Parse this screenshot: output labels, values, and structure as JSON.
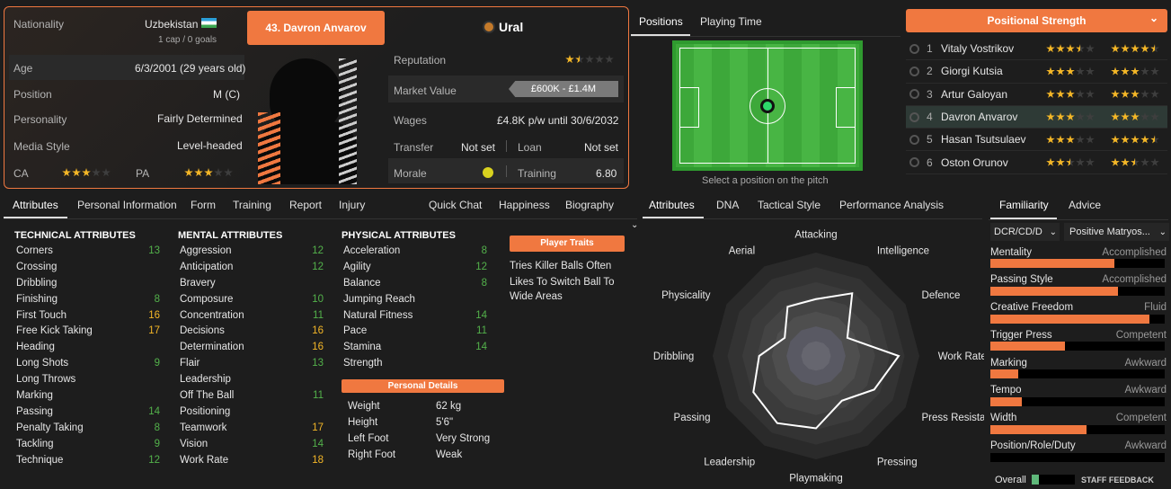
{
  "header": {
    "nationality_label": "Nationality",
    "nationality": "Uzbekistan",
    "caps": "1 cap / 0 goals",
    "player_button": "43. Davron Anvarov",
    "club": "Ural",
    "age_label": "Age",
    "age": "6/3/2001 (29 years old)",
    "position_label": "Position",
    "position": "M (C)",
    "personality_label": "Personality",
    "personality": "Fairly Determined",
    "media_label": "Media Style",
    "media": "Level-headed",
    "ca_label": "CA",
    "pa_label": "PA",
    "ca_stars": 3,
    "pa_stars": 3,
    "reputation_label": "Reputation",
    "reputation_stars": 1.5,
    "market_label": "Market Value",
    "market_value": "£600K - £1.4M",
    "wages_label": "Wages",
    "wages": "£4.8K p/w until 30/6/2032",
    "transfer_label": "Transfer",
    "transfer": "Not set",
    "loan_label": "Loan",
    "loan": "Not set",
    "morale_label": "Morale",
    "training_label": "Training",
    "training": "6.80"
  },
  "pitch": {
    "tabs": [
      "Positions",
      "Playing Time"
    ],
    "hint": "Select a position on the pitch"
  },
  "pos_strength": {
    "title": "Positional Strength",
    "rows": [
      {
        "n": "1",
        "name": "Vitaly Vostrikov",
        "a": 3.5,
        "b": 4.5,
        "sel": false
      },
      {
        "n": "2",
        "name": "Giorgi Kutsia",
        "a": 3,
        "b": 3,
        "sel": false
      },
      {
        "n": "3",
        "name": "Artur Galoyan",
        "a": 3,
        "b": 3,
        "sel": false
      },
      {
        "n": "4",
        "name": "Davron Anvarov",
        "a": 3,
        "b": 3,
        "sel": true
      },
      {
        "n": "5",
        "name": "Hasan Tsutsulaev",
        "a": 3,
        "b": 4.5,
        "sel": false
      },
      {
        "n": "6",
        "name": "Oston Orunov",
        "a": 2.5,
        "b": 2.5,
        "sel": false
      }
    ]
  },
  "main_tabs": [
    "Attributes",
    "Personal Information",
    "Form",
    "Training",
    "Report",
    "Injury",
    "Quick Chat",
    "Happiness",
    "Biography"
  ],
  "technical": {
    "title": "TECHNICAL ATTRIBUTES",
    "items": [
      [
        "Corners",
        "13",
        "g"
      ],
      [
        "Crossing",
        "",
        ""
      ],
      [
        "Dribbling",
        "",
        ""
      ],
      [
        "Finishing",
        "8",
        "g"
      ],
      [
        "First Touch",
        "16",
        "y"
      ],
      [
        "Free Kick Taking",
        "17",
        "y"
      ],
      [
        "Heading",
        "",
        ""
      ],
      [
        "Long Shots",
        "9",
        "g"
      ],
      [
        "Long Throws",
        "",
        ""
      ],
      [
        "Marking",
        "",
        ""
      ],
      [
        "Passing",
        "14",
        "g"
      ],
      [
        "Penalty Taking",
        "8",
        "g"
      ],
      [
        "Tackling",
        "9",
        "g"
      ],
      [
        "Technique",
        "12",
        "g"
      ]
    ]
  },
  "mental": {
    "title": "MENTAL ATTRIBUTES",
    "items": [
      [
        "Aggression",
        "12",
        "g"
      ],
      [
        "Anticipation",
        "12",
        "g"
      ],
      [
        "Bravery",
        "",
        ""
      ],
      [
        "Composure",
        "10",
        "g"
      ],
      [
        "Concentration",
        "11",
        "g"
      ],
      [
        "Decisions",
        "16",
        "y"
      ],
      [
        "Determination",
        "16",
        "y"
      ],
      [
        "Flair",
        "13",
        "g"
      ],
      [
        "Leadership",
        "",
        ""
      ],
      [
        "Off The Ball",
        "11",
        "g"
      ],
      [
        "Positioning",
        "",
        ""
      ],
      [
        "Teamwork",
        "17",
        "y"
      ],
      [
        "Vision",
        "14",
        "g"
      ],
      [
        "Work Rate",
        "18",
        "y"
      ]
    ]
  },
  "physical": {
    "title": "PHYSICAL ATTRIBUTES",
    "items": [
      [
        "Acceleration",
        "8",
        "g"
      ],
      [
        "Agility",
        "12",
        "g"
      ],
      [
        "Balance",
        "8",
        "g"
      ],
      [
        "Jumping Reach",
        "",
        ""
      ],
      [
        "Natural Fitness",
        "14",
        "g"
      ],
      [
        "Pace",
        "11",
        "g"
      ],
      [
        "Stamina",
        "14",
        "g"
      ],
      [
        "Strength",
        "",
        ""
      ]
    ]
  },
  "traits": {
    "title": "Player Traits",
    "items": [
      "Tries Killer Balls Often",
      "Likes To Switch Ball To Wide Areas"
    ]
  },
  "personal": {
    "title": "Personal Details",
    "items": [
      [
        "Weight",
        "62 kg"
      ],
      [
        "Height",
        "5'6\""
      ],
      [
        "Left Foot",
        "Very Strong"
      ],
      [
        "Right Foot",
        "Weak"
      ]
    ]
  },
  "radar": {
    "tabs": [
      "Attributes",
      "DNA",
      "Tactical Style",
      "Performance Analysis"
    ],
    "labels": [
      "Attacking",
      "Intelligence",
      "Defence",
      "Work Rate",
      "Press Resistance",
      "Pressing",
      "Playmaking",
      "Leadership",
      "Passing",
      "Dribbling",
      "Physicality",
      "Aerial"
    ],
    "values": [
      0.55,
      0.7,
      0.35,
      0.8,
      0.65,
      0.5,
      0.7,
      0.75,
      0.7,
      0.55,
      0.35,
      0.55
    ]
  },
  "familiarity": {
    "tabs": [
      "Familiarity",
      "Advice"
    ],
    "select1": "DCR/CD/D",
    "select2": "Positive Matryos...",
    "rows": [
      [
        "Mentality",
        "Accomplished",
        0.71
      ],
      [
        "Passing Style",
        "Accomplished",
        0.73
      ],
      [
        "Creative Freedom",
        "Fluid",
        0.91
      ],
      [
        "Trigger Press",
        "Competent",
        0.43
      ],
      [
        "Marking",
        "Awkward",
        0.16
      ],
      [
        "Tempo",
        "Awkward",
        0.18
      ],
      [
        "Width",
        "Competent",
        0.55
      ],
      [
        "Position/Role/Duty",
        "Awkward",
        0
      ]
    ],
    "overall_label": "Overall",
    "staff": "STAFF FEEDBACK"
  }
}
